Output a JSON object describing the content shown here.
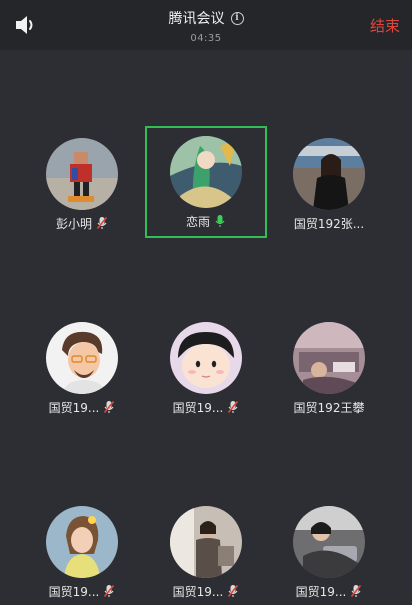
{
  "header": {
    "title": "腾讯会议",
    "timer": "04:35",
    "end_label": "结束",
    "speaker_icon": "speaker-icon",
    "info_icon": "info-icon"
  },
  "colors": {
    "background": "#2d2e33",
    "topbar": "#25262a",
    "end": "#e0453b",
    "active_border": "#2fbf54",
    "mic_active": "#3ccf5a",
    "mic_muted": "#e0453b"
  },
  "participants": [
    {
      "name": "彭小明",
      "mic": "muted",
      "active": false
    },
    {
      "name": "恋雨",
      "mic": "speaking",
      "active": true
    },
    {
      "name": "国贸192张...",
      "mic": "none",
      "active": false
    },
    {
      "name": "国贸19...",
      "mic": "muted",
      "active": false
    },
    {
      "name": "国贸19...",
      "mic": "muted",
      "active": false
    },
    {
      "name": "国贸192王攀",
      "mic": "none",
      "active": false
    },
    {
      "name": "国贸19...",
      "mic": "muted",
      "active": false
    },
    {
      "name": "国贸19...",
      "mic": "muted",
      "active": false
    },
    {
      "name": "国贸19...",
      "mic": "muted",
      "active": false
    }
  ]
}
